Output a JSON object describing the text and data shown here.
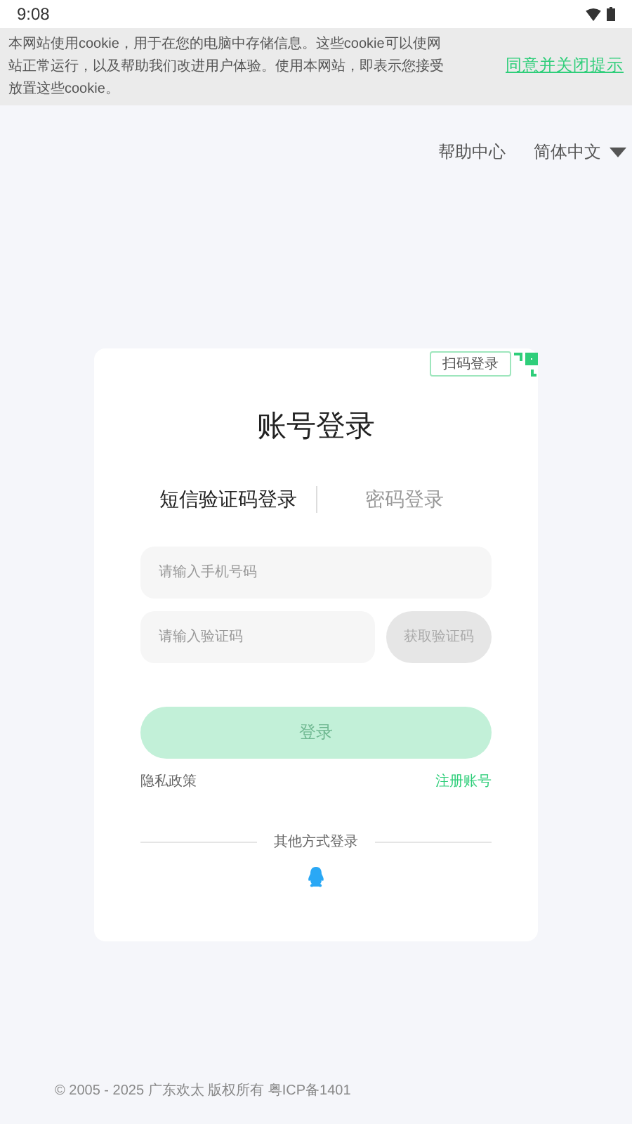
{
  "status_bar": {
    "time": "9:08"
  },
  "cookie_banner": {
    "text": "本网站使用cookie，用于在您的电脑中存储信息。这些cookie可以使网站正常运行，以及帮助我们改进用户体验。使用本网站，即表示您接受放置这些cookie。",
    "accept": "同意并关闭提示"
  },
  "header": {
    "help": "帮助中心",
    "language": "简体中文"
  },
  "login": {
    "qr_tip": "扫码登录",
    "title": "账号登录",
    "tabs": [
      {
        "label": "短信验证码登录",
        "selected": true
      },
      {
        "label": "密码登录",
        "selected": false
      }
    ],
    "phone": {
      "placeholder": "请输入手机号码"
    },
    "code": {
      "placeholder": "请输入验证码"
    },
    "get_code": "获取验证码",
    "submit": {
      "label": "登录",
      "disabled": true
    },
    "privacy": "隐私政策",
    "register": "注册账号",
    "other": "其他方式登录"
  },
  "footer": "© 2005 - 2025 广东欢太 版权所有 粤ICP备1401"
}
